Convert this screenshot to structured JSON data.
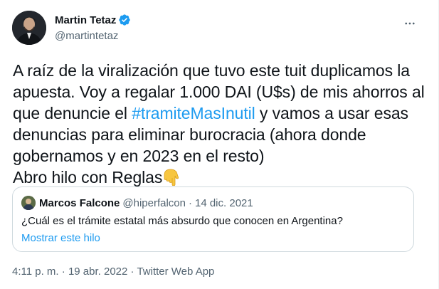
{
  "author": {
    "name": "Martin Tetaz",
    "handle": "@martintetaz",
    "verified": true
  },
  "tweet": {
    "text_before": "A raíz de la viralización que tuvo este tuit duplicamos la apuesta. Voy a regalar 1.000 DAI (U$s) de mis ahorros al que denuncie el ",
    "hashtag": "#tramiteMasInutil",
    "text_after": " y vamos a usar esas denuncias para  eliminar burocracia (ahora donde gobernamos y en 2023 en el resto)",
    "last_line": "Abro hilo con Reglas",
    "emoji": "pointing-down-hand"
  },
  "quote": {
    "name": "Marcos Falcone",
    "handle": "@hiperfalcon",
    "separator": "·",
    "date": "14 dic. 2021",
    "text": "¿Cuál es el trámite estatal más absurdo que conocen en Argentina?",
    "link": "Mostrar este hilo"
  },
  "meta": {
    "time": "4:11 p. m.",
    "separator": "·",
    "date": "19 abr. 2022",
    "source": "Twitter Web App"
  },
  "colors": {
    "link": "#1d9bf0",
    "secondary": "#536471",
    "border": "#cfd9de"
  }
}
